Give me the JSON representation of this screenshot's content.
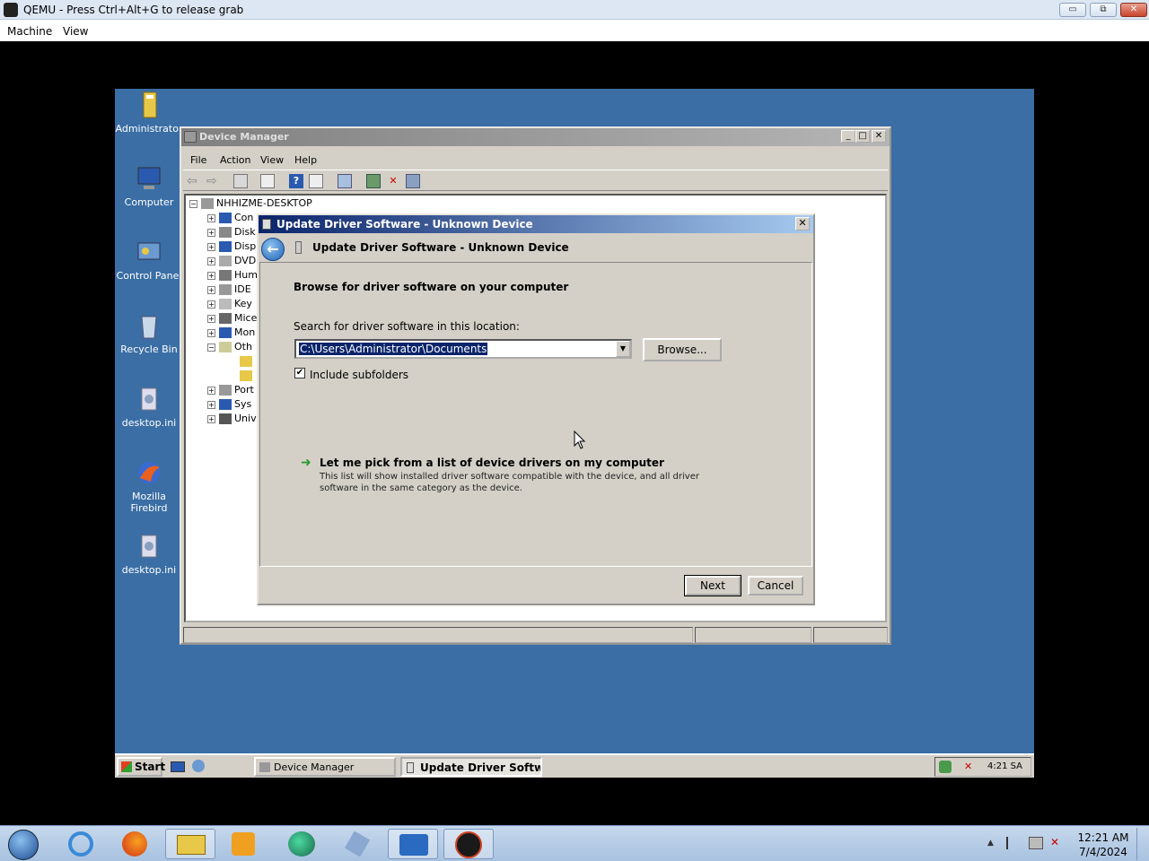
{
  "host": {
    "title": "QEMU - Press Ctrl+Alt+G to release grab",
    "menu": [
      "Machine",
      "View"
    ],
    "controls": {
      "minimize": "▭",
      "restore": "⧉",
      "close": "✕"
    }
  },
  "desktop": {
    "icons": [
      {
        "label": "Administrator",
        "icon": "folder-user-icon"
      },
      {
        "label": "Computer",
        "icon": "computer-icon"
      },
      {
        "label": "Control Panel",
        "icon": "control-panel-icon"
      },
      {
        "label": "Recycle Bin",
        "icon": "recycle-bin-icon"
      },
      {
        "label": "desktop.ini",
        "icon": "settings-file-icon"
      },
      {
        "label": "Mozilla Firebird",
        "icon": "firebird-icon"
      },
      {
        "label": "desktop.ini",
        "icon": "settings-file-icon"
      }
    ]
  },
  "device_manager": {
    "title": "Device Manager",
    "menu": [
      "File",
      "Action",
      "View",
      "Help"
    ],
    "tree_root": "NHHIZME-DESKTOP",
    "tree_items": [
      "Con",
      "Disk",
      "Disp",
      "DVD",
      "Hum",
      "IDE",
      "Key",
      "Mice",
      "Mon",
      "Oth",
      "",
      "",
      "Port",
      "Sys",
      "Univ"
    ]
  },
  "wizard": {
    "title": "Update Driver Software - Unknown Device",
    "heading": "Update Driver Software - Unknown Device",
    "subheading": "Browse for driver software on your computer",
    "location_label": "Search for driver software in this location:",
    "location_value": "C:\\Users\\Administrator\\Documents",
    "browse_label": "Browse...",
    "include_subfolders_label": "Include subfolders",
    "include_subfolders_checked": true,
    "pick_link": "Let me pick from a list of device drivers on my computer",
    "pick_desc": "This list will show installed driver software compatible with the device, and all driver software in the same category as the device.",
    "next_label": "Next",
    "cancel_label": "Cancel",
    "close_label": "✕",
    "back_glyph": "←",
    "arrow_glyph": "➜"
  },
  "guest_taskbar": {
    "start_label": "Start",
    "tasks": [
      "Device Manager",
      "Update Driver Softwa..."
    ],
    "clock": "4:21 SA"
  },
  "host_taskbar": {
    "time": "12:21 AM",
    "date": "7/4/2024",
    "apps": [
      "start-orb-icon",
      "internet-explorer-icon",
      "firefox-icon",
      "file-explorer-icon",
      "media-player-icon",
      "app-green-icon",
      "tool-icon",
      "powershell-icon",
      "qemu-icon"
    ]
  }
}
